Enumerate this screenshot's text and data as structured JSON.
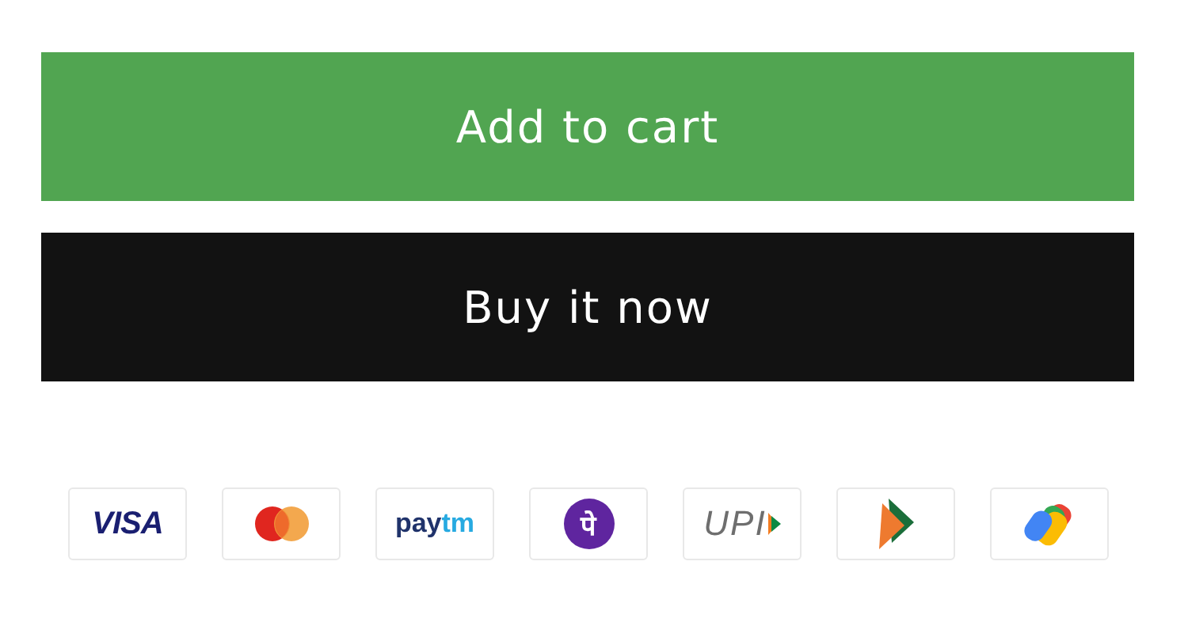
{
  "buttons": [
    {
      "kind": "primary",
      "label": "Add to cart"
    },
    {
      "kind": "dark",
      "label": "Buy it now"
    }
  ],
  "payment_methods": [
    {
      "kind": "visa",
      "text": "VISA"
    },
    {
      "kind": "mastercard"
    },
    {
      "kind": "paytm",
      "text": "pay",
      "text_2": "tm"
    },
    {
      "kind": "phonepe",
      "text": "पे"
    },
    {
      "kind": "upi",
      "text": "UPI"
    },
    {
      "kind": "bhim"
    },
    {
      "kind": "gpay"
    }
  ]
}
